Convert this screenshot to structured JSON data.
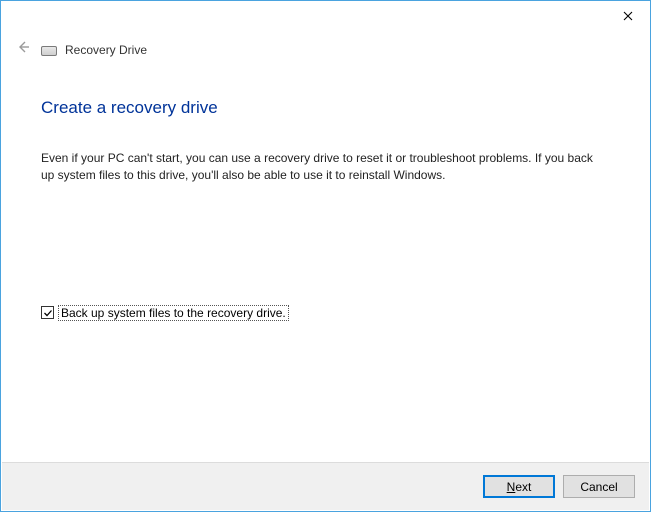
{
  "titlebar": {
    "wizard_name": "Recovery Drive"
  },
  "page": {
    "title": "Create a recovery drive",
    "description": "Even if your PC can't start, you can use a recovery drive to reset it or troubleshoot problems. If you back up system files to this drive, you'll also be able to use it to reinstall Windows."
  },
  "checkbox": {
    "checked": true,
    "label": "Back up system files to the recovery drive."
  },
  "footer": {
    "next_prefix": "N",
    "next_suffix": "ext",
    "cancel": "Cancel"
  }
}
